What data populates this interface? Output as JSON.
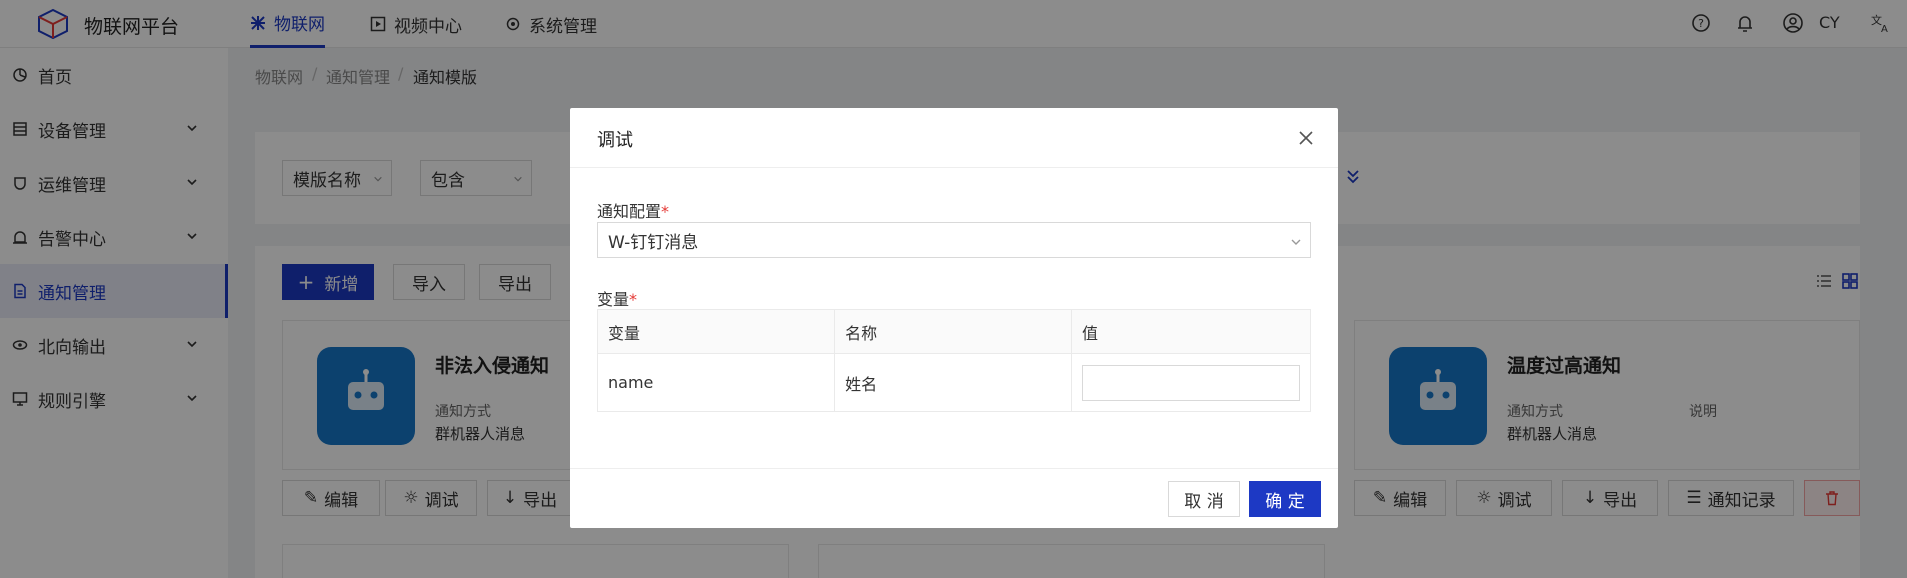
{
  "app": {
    "title": "物联网平台"
  },
  "topnav": {
    "tabs": [
      {
        "label": "物联网",
        "icon": "iot-icon",
        "active": true
      },
      {
        "label": "视频中心",
        "icon": "video-icon",
        "active": false
      },
      {
        "label": "系统管理",
        "icon": "settings-icon",
        "active": false
      }
    ],
    "user": "CY",
    "accent": "#1d39c4"
  },
  "sidebar": {
    "items": [
      {
        "label": "首页",
        "icon": "dashboard-icon"
      },
      {
        "label": "设备管理",
        "icon": "device-icon"
      },
      {
        "label": "运维管理",
        "icon": "ops-icon"
      },
      {
        "label": "告警中心",
        "icon": "alarm-icon"
      },
      {
        "label": "通知管理",
        "icon": "notice-icon",
        "active": true
      },
      {
        "label": "北向输出",
        "icon": "output-icon"
      },
      {
        "label": "规则引擎",
        "icon": "rule-icon"
      }
    ]
  },
  "breadcrumb": [
    "物联网",
    "通知管理",
    "通知模版"
  ],
  "filter": {
    "field": "模版名称",
    "op": "包含"
  },
  "toolbar": {
    "add": "新增",
    "import": "导入",
    "export": "导出"
  },
  "cards": [
    {
      "title": "非法入侵通知",
      "type_label": "通知方式",
      "type_value": "群机器人消息",
      "actions": {
        "edit": "编辑",
        "debug": "调试",
        "export": "导出"
      }
    },
    {
      "title": "温度过高通知",
      "type_label": "通知方式",
      "type_value": "群机器人消息",
      "desc_label": "说明",
      "actions": {
        "edit": "编辑",
        "debug": "调试",
        "export": "导出",
        "records": "通知记录"
      }
    }
  ],
  "modal": {
    "title": "调试",
    "config_label": "通知配置",
    "config_value": "W-钉钉消息",
    "vars_label": "变量",
    "required_mark": "*",
    "table": {
      "headers": [
        "变量",
        "名称",
        "值"
      ],
      "rows": [
        {
          "var": "name",
          "name": "姓名",
          "value": ""
        }
      ]
    },
    "cancel": "取 消",
    "ok": "确 定"
  }
}
